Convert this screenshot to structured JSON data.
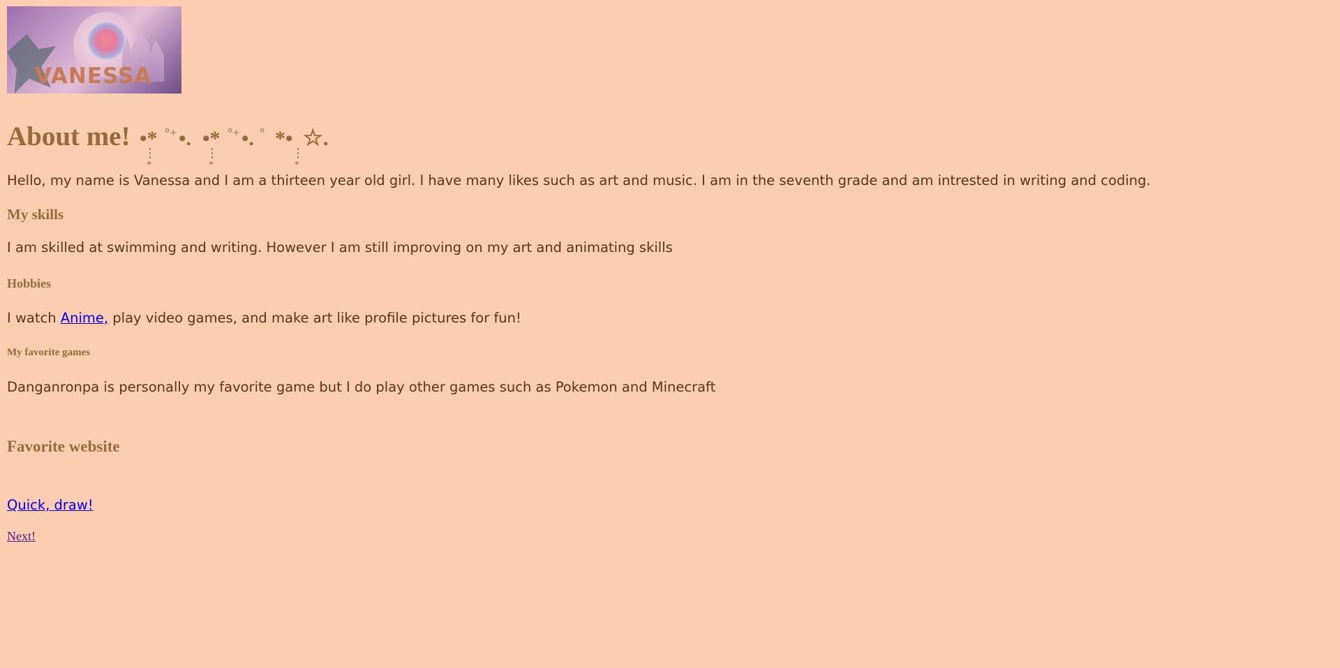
{
  "header": {
    "banner_text": "VANESSA"
  },
  "about": {
    "title": "About me!",
    "decoration": "•*°+•. •*°+•.° *• ☆.",
    "intro": "Hello, my name is Vanessa and I am a thirteen year old girl. I have many likes such as art and music. I am in the seventh grade and am intrested in writing and coding."
  },
  "skills": {
    "heading": "My skills",
    "text": "I am skilled at swimming and writing. However I am still improving on my art and animating skills"
  },
  "hobbies": {
    "heading": "Hobbies",
    "text_before": "I watch ",
    "anime_link": "Anime,",
    "text_after": " play video games, and make art like profile pictures for fun!"
  },
  "games": {
    "heading": "My favorite games",
    "text": "Danganronpa is personally my favorite game but I do play other games such as Pokemon and Minecraft"
  },
  "website": {
    "heading": "Favorite website",
    "link": "Quick, draw!"
  },
  "nav": {
    "next_link": "Next!"
  },
  "colors": {
    "background": "#fccdb0",
    "heading": "#9b6a3a",
    "body_text": "#5a3418",
    "link": "#0000ee",
    "visited_link": "#551a8b"
  }
}
